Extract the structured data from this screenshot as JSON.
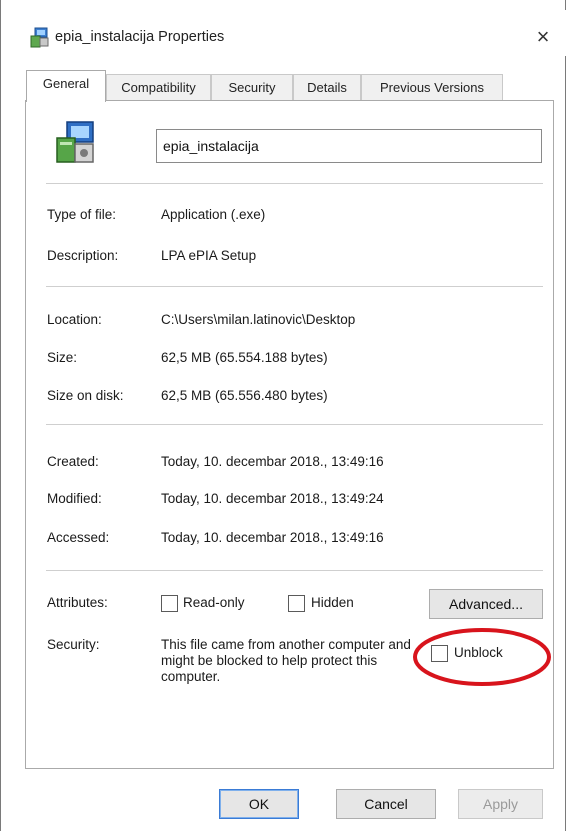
{
  "window": {
    "title": "epia_instalacija Properties",
    "close_glyph": "×",
    "app_icon": "setup-exe-icon"
  },
  "tabs": [
    {
      "label": "General",
      "active": true
    },
    {
      "label": "Compatibility",
      "active": false
    },
    {
      "label": "Security",
      "active": false
    },
    {
      "label": "Details",
      "active": false
    },
    {
      "label": "Previous Versions",
      "active": false
    }
  ],
  "file": {
    "icon": "setup-exe-icon",
    "name_value": "epia_instalacija"
  },
  "properties": {
    "type_of_file": {
      "label": "Type of file:",
      "value": "Application (.exe)"
    },
    "description": {
      "label": "Description:",
      "value": "LPA ePIA Setup"
    },
    "location": {
      "label": "Location:",
      "value": "C:\\Users\\milan.latinovic\\Desktop"
    },
    "size": {
      "label": "Size:",
      "value": "62,5 MB (65.554.188 bytes)"
    },
    "size_on_disk": {
      "label": "Size on disk:",
      "value": "62,5 MB (65.556.480 bytes)"
    },
    "created": {
      "label": "Created:",
      "value": "Today, 10. decembar 2018., 13:49:16"
    },
    "modified": {
      "label": "Modified:",
      "value": "Today, 10. decembar 2018., 13:49:24"
    },
    "accessed": {
      "label": "Accessed:",
      "value": "Today, 10. decembar 2018., 13:49:16"
    }
  },
  "attributes": {
    "label": "Attributes:",
    "read_only_label": "Read-only",
    "read_only_checked": false,
    "hidden_label": "Hidden",
    "hidden_checked": false,
    "advanced_label": "Advanced..."
  },
  "security": {
    "label": "Security:",
    "text": "This file came from another computer and might be blocked to help protect this computer.",
    "unblock_label": "Unblock",
    "unblock_checked": false,
    "annotation_color": "#d8141c"
  },
  "buttons": {
    "ok": "OK",
    "cancel": "Cancel",
    "apply": "Apply"
  }
}
